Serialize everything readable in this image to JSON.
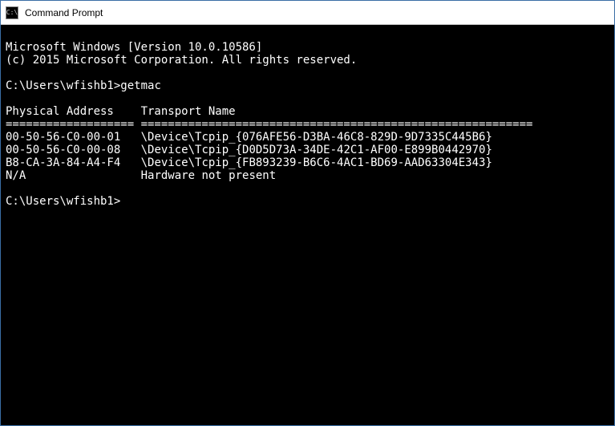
{
  "window": {
    "title": "Command Prompt"
  },
  "terminal": {
    "version_line": "Microsoft Windows [Version 10.0.10586]",
    "copyright_line": "(c) 2015 Microsoft Corporation. All rights reserved.",
    "prompt1": "C:\\Users\\wfishb1>",
    "command1": "getmac",
    "header_physical": "Physical Address",
    "header_transport": "Transport Name",
    "separator": "=================== ==========================================================",
    "rows": [
      {
        "phys": "00-50-56-C0-00-01",
        "transport": "\\Device\\Tcpip_{076AFE56-D3BA-46C8-829D-9D7335C445B6}"
      },
      {
        "phys": "00-50-56-C0-00-08",
        "transport": "\\Device\\Tcpip_{D0D5D73A-34DE-42C1-AF00-E899B0442970}"
      },
      {
        "phys": "B8-CA-3A-84-A4-F4",
        "transport": "\\Device\\Tcpip_{FB893239-B6C6-4AC1-BD69-AAD63304E343}"
      },
      {
        "phys": "N/A",
        "transport": "Hardware not present"
      }
    ],
    "prompt2": "C:\\Users\\wfishb1>"
  }
}
